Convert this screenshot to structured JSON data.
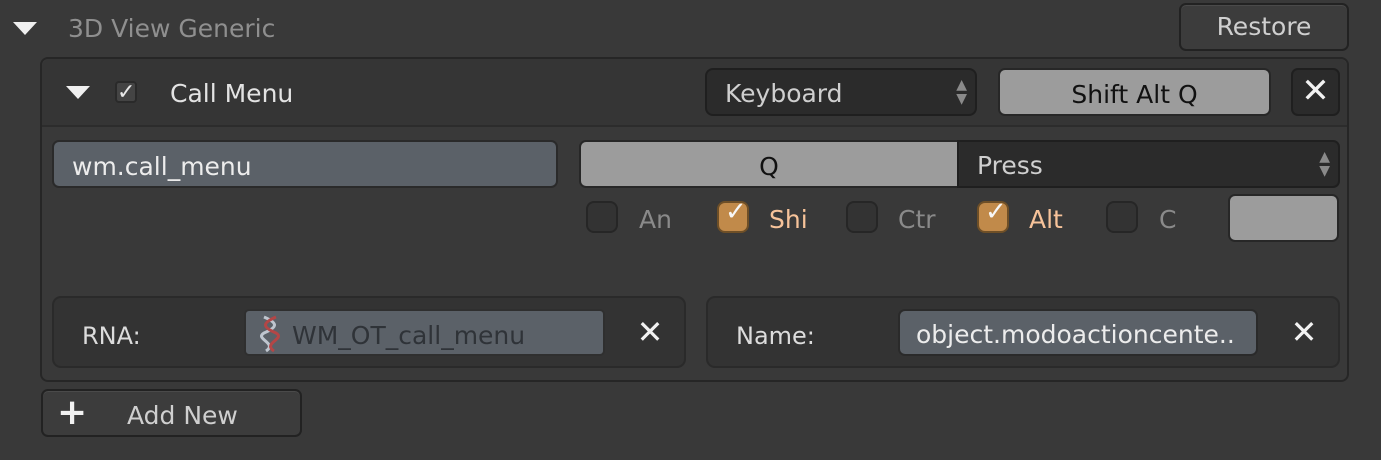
{
  "header": {
    "title": "3D View Generic",
    "restore_label": "Restore"
  },
  "item": {
    "enabled": true,
    "name": "Call Menu",
    "map_type": "Keyboard",
    "shortcut": "Shift Alt Q",
    "operator_id": "wm.call_menu",
    "key": "Q",
    "event_value": "Press",
    "modifiers": [
      {
        "label": "An",
        "checked": false
      },
      {
        "label": "Shi",
        "checked": true
      },
      {
        "label": "Ctr",
        "checked": false
      },
      {
        "label": "Alt",
        "checked": true
      },
      {
        "label": "C",
        "checked": false
      }
    ],
    "key_modifier_value": ""
  },
  "properties": {
    "rna_label": "RNA:",
    "rna_value": "WM_OT_call_menu",
    "name_label": "Name:",
    "name_value": "object.modoactioncente.."
  },
  "footer": {
    "add_new_label": "Add New"
  },
  "colors": {
    "background": "#393939",
    "checked_modifier": "#c18a4a",
    "checked_label": "#f7c39a",
    "text_field": "#5b6168"
  }
}
